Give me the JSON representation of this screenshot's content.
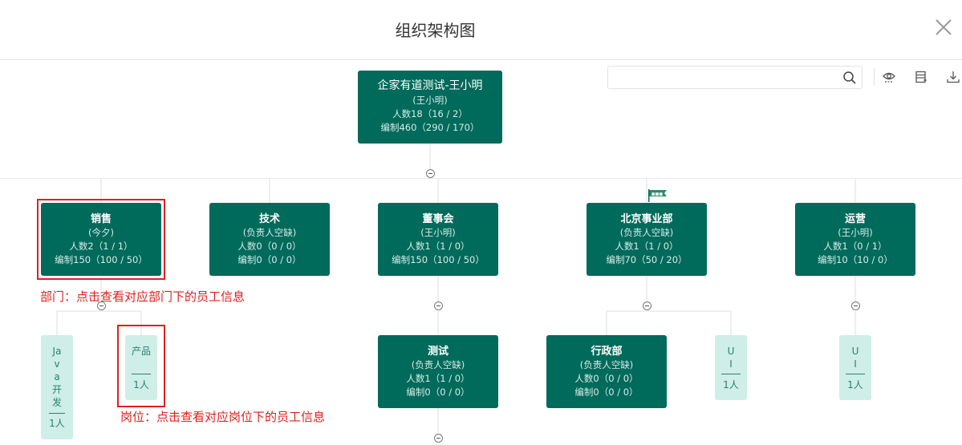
{
  "header": {
    "title": "组织架构图"
  },
  "search": {
    "placeholder": "",
    "value": ""
  },
  "toolbar": {
    "icons": [
      "eye-icon",
      "list-icon",
      "download-icon"
    ]
  },
  "org": {
    "root": {
      "name": "企家有道测试-王小明",
      "leader": "(王小明)",
      "headcount": "人数18（16 / 2）",
      "quota": "编制460（290 / 170）"
    },
    "departments": [
      {
        "name": "销售",
        "leader": "(今夕)",
        "headcount": "人数2（1 / 1）",
        "quota": "编制150（100 / 50）"
      },
      {
        "name": "技术",
        "leader": "(负责人空缺)",
        "headcount": "人数0（0 / 0）",
        "quota": "编制0（0 / 0）"
      },
      {
        "name": "董事会",
        "leader": "(王小明)",
        "headcount": "人数1（1 / 0）",
        "quota": "编制150（100 / 50）"
      },
      {
        "name": "北京事业部",
        "leader": "(负责人空缺)",
        "headcount": "人数1（1 / 0）",
        "quota": "编制70（50 / 20）"
      },
      {
        "name": "运营",
        "leader": "(王小明)",
        "headcount": "人数1（0 / 1）",
        "quota": "编制10（10 / 0）"
      }
    ],
    "subdepartments": [
      {
        "name": "测试",
        "leader": "(负责人空缺)",
        "headcount": "人数1（1 / 0）",
        "quota": "编制0（0 / 0）"
      },
      {
        "name": "行政部",
        "leader": "(负责人空缺)",
        "headcount": "人数0（0 / 0）",
        "quota": "编制0（0 / 0）"
      }
    ],
    "posts": [
      {
        "name": "Java开发",
        "count": "1人"
      },
      {
        "name": "产品",
        "count": "1人"
      },
      {
        "name": "UI",
        "count": "1人"
      },
      {
        "name": "UI",
        "count": "1人"
      }
    ],
    "flag_label": "■■■"
  },
  "annotations": {
    "department": "部门：点击查看对应部门下的员工信息",
    "post": "岗位：点击查看对应岗位下的员工信息"
  },
  "colors": {
    "node": "#006a5b",
    "post": "#cfeee7",
    "annotation": "#e02020"
  }
}
